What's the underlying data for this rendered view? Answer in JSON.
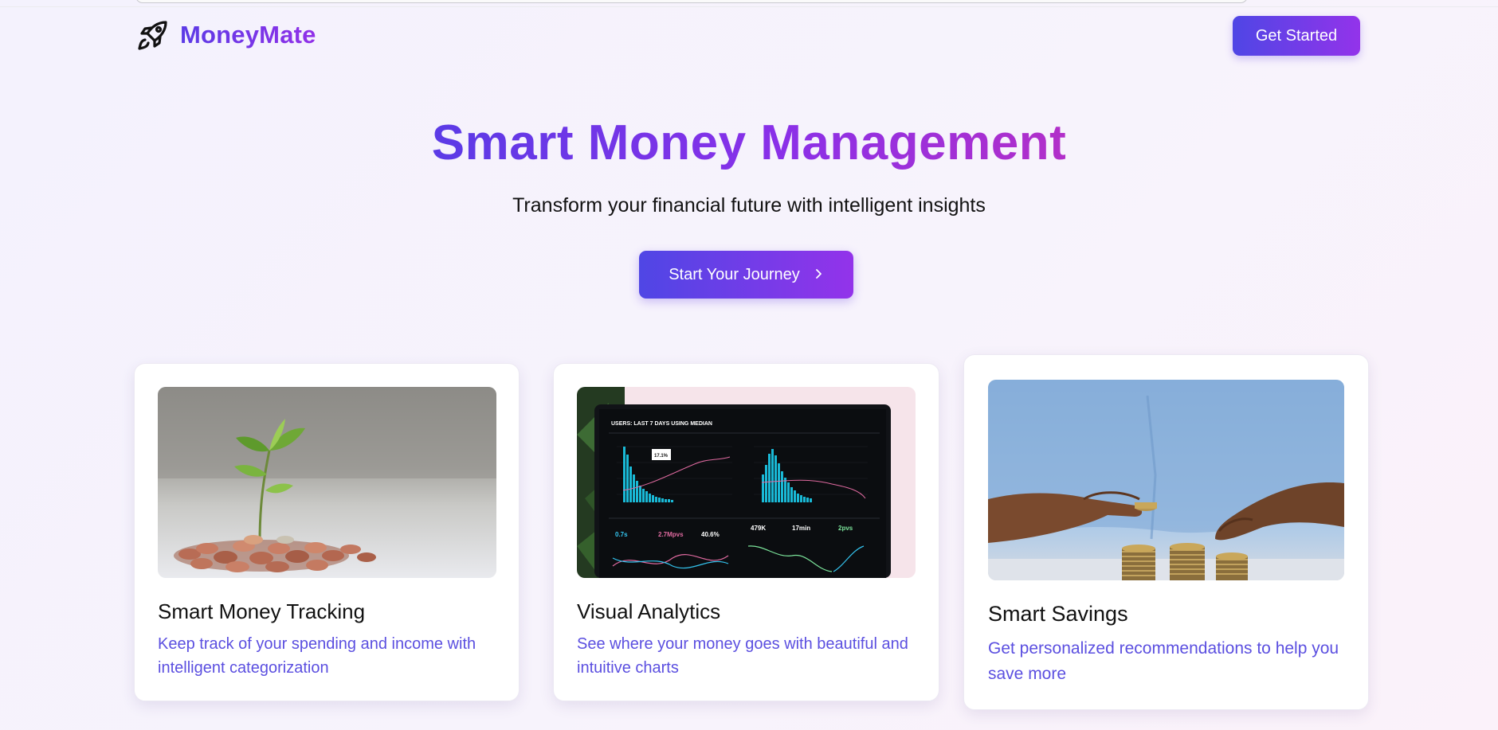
{
  "header": {
    "brand_name": "MoneyMate",
    "brand_icon": "rocket-icon",
    "cta_label": "Get Started"
  },
  "hero": {
    "title": "Smart Money Management",
    "subtitle": "Transform your financial future with intelligent insights",
    "cta_label": "Start Your Journey",
    "cta_icon": "chevron-right-icon"
  },
  "features": [
    {
      "title": "Smart Money Tracking",
      "description": "Keep track of your spending and income with intelligent categorization",
      "image": "plant-growing-from-coins-photo"
    },
    {
      "title": "Visual Analytics",
      "description": "See where your money goes with beautiful and intuitive charts",
      "image": "analytics-dashboard-laptop-photo",
      "image_text": {
        "header": "USERS: LAST 7 DAYS USING MEDIAN",
        "tooltip": "17.1%",
        "metrics": [
          "0.7s",
          "2.7Mpvs",
          "40.6%",
          "479K",
          "17min",
          "2pvs"
        ]
      }
    },
    {
      "title": "Smart Savings",
      "description": "Get personalized recommendations to help you save more",
      "image": "hands-stacking-coins-photo"
    }
  ],
  "colors": {
    "brand_gradient_start": "#4f46e5",
    "brand_gradient_end": "#9333ea",
    "description_text": "#5b4fe0"
  }
}
